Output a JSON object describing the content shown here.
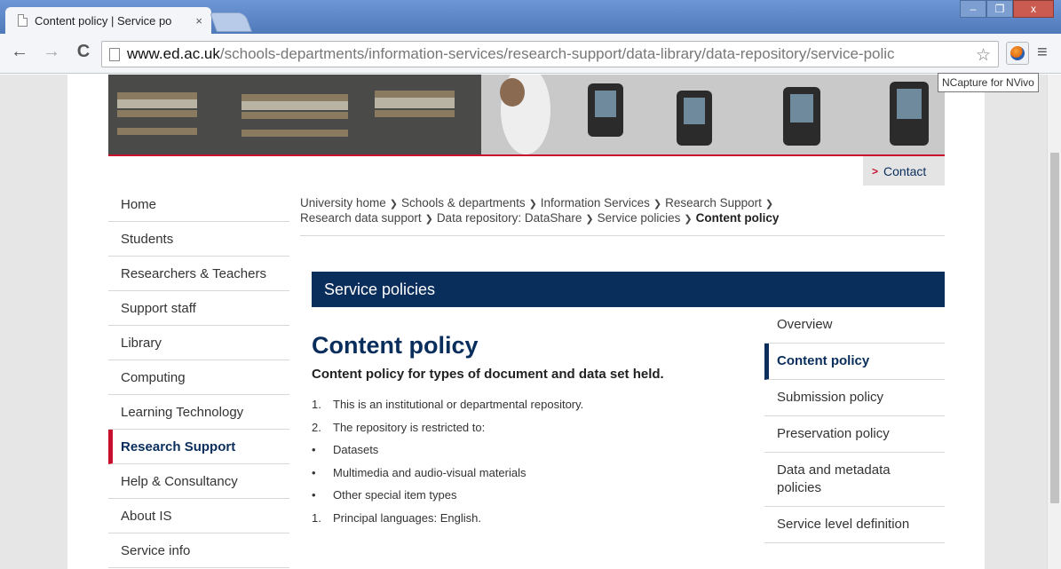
{
  "browser": {
    "tab_title": "Content policy | Service po",
    "tab_close": "×",
    "url_domain": "www.ed.ac.uk",
    "url_path": "/schools-departments/information-services/research-support/data-library/data-repository/service-polic",
    "tooltip": "NCapture for NVivo",
    "back_glyph": "←",
    "forward_glyph": "→",
    "reload_glyph": "C",
    "star_glyph": "☆",
    "menu_glyph": "≡",
    "min_glyph": "–",
    "max_glyph": "❐",
    "close_glyph": "x"
  },
  "header": {
    "contact_label": "Contact"
  },
  "leftnav": {
    "items": [
      {
        "label": "Home"
      },
      {
        "label": "Students"
      },
      {
        "label": "Researchers & Teachers"
      },
      {
        "label": "Support staff"
      },
      {
        "label": "Library"
      },
      {
        "label": "Computing"
      },
      {
        "label": "Learning Technology"
      },
      {
        "label": "Research Support"
      },
      {
        "label": "Help & Consultancy"
      },
      {
        "label": "About IS"
      },
      {
        "label": "Service info"
      }
    ]
  },
  "breadcrumb": {
    "items": [
      "University home",
      "Schools & departments",
      "Information Services",
      "Research Support",
      "Research data support",
      "Data repository: DataShare",
      "Service policies"
    ],
    "current": "Content policy",
    "sep": "❯"
  },
  "section": {
    "title": "Service policies"
  },
  "main": {
    "heading": "Content policy",
    "lead": "Content policy for types of document and data set held.",
    "lines": [
      {
        "mark": "1.",
        "text": "This is an institutional or departmental repository."
      },
      {
        "mark": "2.",
        "text": "The repository is restricted to:"
      },
      {
        "mark": "•",
        "text": "Datasets"
      },
      {
        "mark": "•",
        "text": "Multimedia and audio-visual materials"
      },
      {
        "mark": "•",
        "text": "Other special item types"
      },
      {
        "mark": "1.",
        "text": "Principal languages: English."
      }
    ]
  },
  "subnav": {
    "items": [
      {
        "label": "Overview"
      },
      {
        "label": "Content policy"
      },
      {
        "label": "Submission policy"
      },
      {
        "label": "Preservation policy"
      },
      {
        "label": "Data and metadata policies"
      },
      {
        "label": "Service level definition"
      }
    ]
  },
  "colors": {
    "brand_navy": "#0a2e5c",
    "accent_red": "#c8102e"
  }
}
